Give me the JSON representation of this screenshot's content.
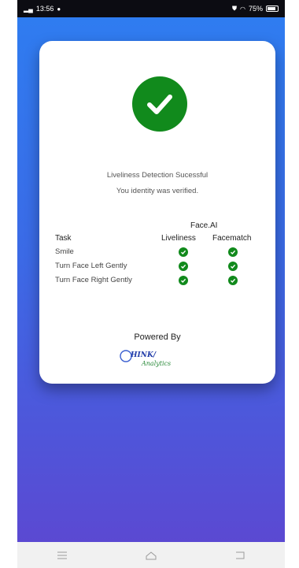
{
  "status_bar": {
    "time": "13:56",
    "battery": "75%"
  },
  "card": {
    "message_title": "Liveliness Detection Sucessful",
    "message_sub": "You identity was verified.",
    "table": {
      "group_header": "Face.AI",
      "col_task": "Task",
      "col_liveliness": "Liveliness",
      "col_facematch": "Facematch",
      "rows": [
        {
          "task": "Smile",
          "liveliness": "pass",
          "facematch": "pass"
        },
        {
          "task": "Turn Face Left Gently",
          "liveliness": "pass",
          "facematch": "pass"
        },
        {
          "task": "Turn Face Right Gently",
          "liveliness": "pass",
          "facematch": "pass"
        }
      ]
    },
    "powered_by": "Powered By",
    "logo_text": "THINK Analytics"
  },
  "colors": {
    "success": "#118a1c",
    "gradient_top": "#2f7cf0",
    "gradient_bottom": "#5b49d2"
  },
  "nav_icons": [
    "menu-icon",
    "home-icon",
    "back-icon"
  ]
}
